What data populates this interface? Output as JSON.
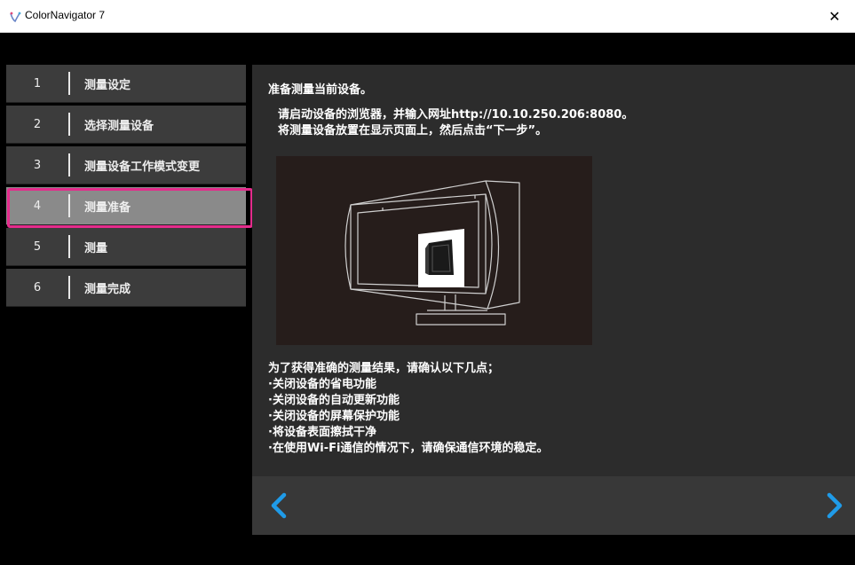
{
  "window": {
    "title": "ColorNavigator 7",
    "close_glyph": "✕"
  },
  "steps": [
    {
      "num": "1",
      "label": "测量设定"
    },
    {
      "num": "2",
      "label": "选择测量设备"
    },
    {
      "num": "3",
      "label": "测量设备工作模式变更"
    },
    {
      "num": "4",
      "label": "测量准备"
    },
    {
      "num": "5",
      "label": "测量"
    },
    {
      "num": "6",
      "label": "测量完成"
    }
  ],
  "active_step": 4,
  "main": {
    "title": "准备测量当前设备。",
    "instructions": [
      "请启动设备的浏览器，并输入网址http://10.10.250.206:8080。",
      "将测量设备放置在显示页面上，然后点击“下一步”。"
    ],
    "checklist_heading": "为了获得准确的测量结果，请确认以下几点；",
    "checklist": [
      "·关闭设备的省电功能",
      "·关闭设备的自动更新功能",
      "·关闭设备的屏幕保护功能",
      "·将设备表面擦拭干净",
      "·在使用Wi-Fi通信的情况下，请确保通信环境的稳定。"
    ]
  },
  "nav": {
    "prev_icon": "chevron-left-icon",
    "next_icon": "chevron-right-icon"
  },
  "colors": {
    "accent_blue": "#1f9be8",
    "highlight_pink": "#e52b8c"
  }
}
